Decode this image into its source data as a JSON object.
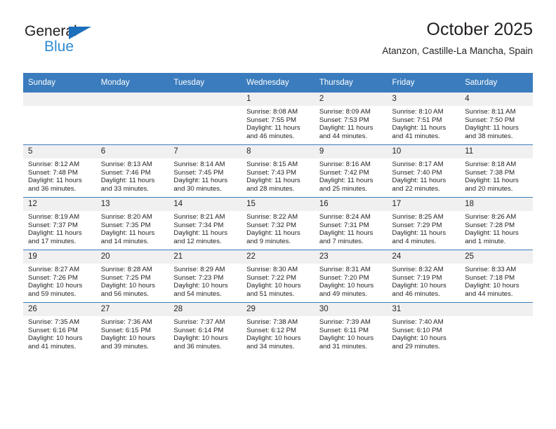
{
  "brand": {
    "name_top": "General",
    "name_bottom": "Blue",
    "triangle_color": "#1c6fba",
    "blue_text_color": "#2e8bd4"
  },
  "header": {
    "title": "October 2025",
    "subtitle": "Atanzon, Castille-La Mancha, Spain"
  },
  "theme": {
    "header_row_bg": "#3a7cbd",
    "day_strip_bg": "#f0f0f0",
    "text_color": "#231f20"
  },
  "weekday_headers": [
    "Sunday",
    "Monday",
    "Tuesday",
    "Wednesday",
    "Thursday",
    "Friday",
    "Saturday"
  ],
  "weeks": [
    [
      {
        "day": "",
        "sunrise": "",
        "sunset": "",
        "daylight_1": "",
        "daylight_2": "",
        "empty": true
      },
      {
        "day": "",
        "sunrise": "",
        "sunset": "",
        "daylight_1": "",
        "daylight_2": "",
        "empty": true
      },
      {
        "day": "",
        "sunrise": "",
        "sunset": "",
        "daylight_1": "",
        "daylight_2": "",
        "empty": true
      },
      {
        "day": "1",
        "sunrise": "Sunrise: 8:08 AM",
        "sunset": "Sunset: 7:55 PM",
        "daylight_1": "Daylight: 11 hours",
        "daylight_2": "and 46 minutes."
      },
      {
        "day": "2",
        "sunrise": "Sunrise: 8:09 AM",
        "sunset": "Sunset: 7:53 PM",
        "daylight_1": "Daylight: 11 hours",
        "daylight_2": "and 44 minutes."
      },
      {
        "day": "3",
        "sunrise": "Sunrise: 8:10 AM",
        "sunset": "Sunset: 7:51 PM",
        "daylight_1": "Daylight: 11 hours",
        "daylight_2": "and 41 minutes."
      },
      {
        "day": "4",
        "sunrise": "Sunrise: 8:11 AM",
        "sunset": "Sunset: 7:50 PM",
        "daylight_1": "Daylight: 11 hours",
        "daylight_2": "and 38 minutes."
      }
    ],
    [
      {
        "day": "5",
        "sunrise": "Sunrise: 8:12 AM",
        "sunset": "Sunset: 7:48 PM",
        "daylight_1": "Daylight: 11 hours",
        "daylight_2": "and 36 minutes."
      },
      {
        "day": "6",
        "sunrise": "Sunrise: 8:13 AM",
        "sunset": "Sunset: 7:46 PM",
        "daylight_1": "Daylight: 11 hours",
        "daylight_2": "and 33 minutes."
      },
      {
        "day": "7",
        "sunrise": "Sunrise: 8:14 AM",
        "sunset": "Sunset: 7:45 PM",
        "daylight_1": "Daylight: 11 hours",
        "daylight_2": "and 30 minutes."
      },
      {
        "day": "8",
        "sunrise": "Sunrise: 8:15 AM",
        "sunset": "Sunset: 7:43 PM",
        "daylight_1": "Daylight: 11 hours",
        "daylight_2": "and 28 minutes."
      },
      {
        "day": "9",
        "sunrise": "Sunrise: 8:16 AM",
        "sunset": "Sunset: 7:42 PM",
        "daylight_1": "Daylight: 11 hours",
        "daylight_2": "and 25 minutes."
      },
      {
        "day": "10",
        "sunrise": "Sunrise: 8:17 AM",
        "sunset": "Sunset: 7:40 PM",
        "daylight_1": "Daylight: 11 hours",
        "daylight_2": "and 22 minutes."
      },
      {
        "day": "11",
        "sunrise": "Sunrise: 8:18 AM",
        "sunset": "Sunset: 7:38 PM",
        "daylight_1": "Daylight: 11 hours",
        "daylight_2": "and 20 minutes."
      }
    ],
    [
      {
        "day": "12",
        "sunrise": "Sunrise: 8:19 AM",
        "sunset": "Sunset: 7:37 PM",
        "daylight_1": "Daylight: 11 hours",
        "daylight_2": "and 17 minutes."
      },
      {
        "day": "13",
        "sunrise": "Sunrise: 8:20 AM",
        "sunset": "Sunset: 7:35 PM",
        "daylight_1": "Daylight: 11 hours",
        "daylight_2": "and 14 minutes."
      },
      {
        "day": "14",
        "sunrise": "Sunrise: 8:21 AM",
        "sunset": "Sunset: 7:34 PM",
        "daylight_1": "Daylight: 11 hours",
        "daylight_2": "and 12 minutes."
      },
      {
        "day": "15",
        "sunrise": "Sunrise: 8:22 AM",
        "sunset": "Sunset: 7:32 PM",
        "daylight_1": "Daylight: 11 hours",
        "daylight_2": "and 9 minutes."
      },
      {
        "day": "16",
        "sunrise": "Sunrise: 8:24 AM",
        "sunset": "Sunset: 7:31 PM",
        "daylight_1": "Daylight: 11 hours",
        "daylight_2": "and 7 minutes."
      },
      {
        "day": "17",
        "sunrise": "Sunrise: 8:25 AM",
        "sunset": "Sunset: 7:29 PM",
        "daylight_1": "Daylight: 11 hours",
        "daylight_2": "and 4 minutes."
      },
      {
        "day": "18",
        "sunrise": "Sunrise: 8:26 AM",
        "sunset": "Sunset: 7:28 PM",
        "daylight_1": "Daylight: 11 hours",
        "daylight_2": "and 1 minute."
      }
    ],
    [
      {
        "day": "19",
        "sunrise": "Sunrise: 8:27 AM",
        "sunset": "Sunset: 7:26 PM",
        "daylight_1": "Daylight: 10 hours",
        "daylight_2": "and 59 minutes."
      },
      {
        "day": "20",
        "sunrise": "Sunrise: 8:28 AM",
        "sunset": "Sunset: 7:25 PM",
        "daylight_1": "Daylight: 10 hours",
        "daylight_2": "and 56 minutes."
      },
      {
        "day": "21",
        "sunrise": "Sunrise: 8:29 AM",
        "sunset": "Sunset: 7:23 PM",
        "daylight_1": "Daylight: 10 hours",
        "daylight_2": "and 54 minutes."
      },
      {
        "day": "22",
        "sunrise": "Sunrise: 8:30 AM",
        "sunset": "Sunset: 7:22 PM",
        "daylight_1": "Daylight: 10 hours",
        "daylight_2": "and 51 minutes."
      },
      {
        "day": "23",
        "sunrise": "Sunrise: 8:31 AM",
        "sunset": "Sunset: 7:20 PM",
        "daylight_1": "Daylight: 10 hours",
        "daylight_2": "and 49 minutes."
      },
      {
        "day": "24",
        "sunrise": "Sunrise: 8:32 AM",
        "sunset": "Sunset: 7:19 PM",
        "daylight_1": "Daylight: 10 hours",
        "daylight_2": "and 46 minutes."
      },
      {
        "day": "25",
        "sunrise": "Sunrise: 8:33 AM",
        "sunset": "Sunset: 7:18 PM",
        "daylight_1": "Daylight: 10 hours",
        "daylight_2": "and 44 minutes."
      }
    ],
    [
      {
        "day": "26",
        "sunrise": "Sunrise: 7:35 AM",
        "sunset": "Sunset: 6:16 PM",
        "daylight_1": "Daylight: 10 hours",
        "daylight_2": "and 41 minutes."
      },
      {
        "day": "27",
        "sunrise": "Sunrise: 7:36 AM",
        "sunset": "Sunset: 6:15 PM",
        "daylight_1": "Daylight: 10 hours",
        "daylight_2": "and 39 minutes."
      },
      {
        "day": "28",
        "sunrise": "Sunrise: 7:37 AM",
        "sunset": "Sunset: 6:14 PM",
        "daylight_1": "Daylight: 10 hours",
        "daylight_2": "and 36 minutes."
      },
      {
        "day": "29",
        "sunrise": "Sunrise: 7:38 AM",
        "sunset": "Sunset: 6:12 PM",
        "daylight_1": "Daylight: 10 hours",
        "daylight_2": "and 34 minutes."
      },
      {
        "day": "30",
        "sunrise": "Sunrise: 7:39 AM",
        "sunset": "Sunset: 6:11 PM",
        "daylight_1": "Daylight: 10 hours",
        "daylight_2": "and 31 minutes."
      },
      {
        "day": "31",
        "sunrise": "Sunrise: 7:40 AM",
        "sunset": "Sunset: 6:10 PM",
        "daylight_1": "Daylight: 10 hours",
        "daylight_2": "and 29 minutes."
      },
      {
        "day": "",
        "sunrise": "",
        "sunset": "",
        "daylight_1": "",
        "daylight_2": "",
        "empty": true
      }
    ]
  ]
}
